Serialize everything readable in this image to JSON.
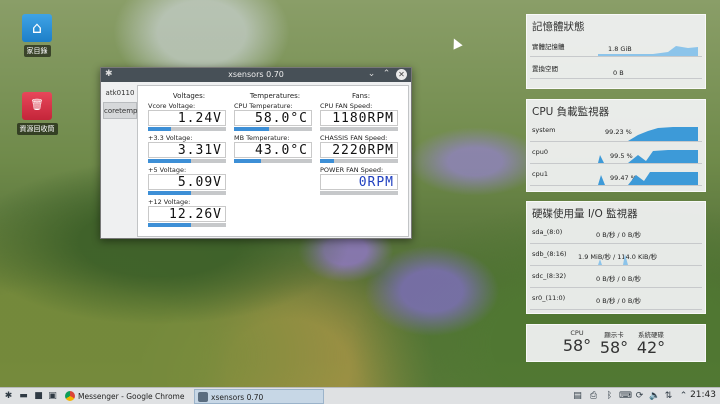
{
  "desktop": {
    "icons": [
      {
        "label": "家目錄",
        "icon": "home-folder-icon"
      },
      {
        "label": "資源回收筒",
        "icon": "trash-icon"
      }
    ]
  },
  "xsensors": {
    "title": "xsensors 0.70",
    "tabs": [
      "atk0110",
      "coretemp"
    ],
    "active_tab": "coretemp",
    "voltages": {
      "header": "Voltages:",
      "items": [
        {
          "label": "Vcore Voltage:",
          "value": "1.24V",
          "level": 0.3
        },
        {
          "label": "+3.3 Voltage:",
          "value": "3.31V",
          "level": 0.55
        },
        {
          "label": "+5 Voltage:",
          "value": "5.09V",
          "level": 0.55
        },
        {
          "label": "+12 Voltage:",
          "value": "12.26V",
          "level": 0.55
        }
      ]
    },
    "temperatures": {
      "header": "Temperatures:",
      "items": [
        {
          "label": "CPU Temperature:",
          "value": "58.0°C",
          "level": 0.45
        },
        {
          "label": "MB Temperature:",
          "value": "43.0°C",
          "level": 0.35
        }
      ]
    },
    "fans": {
      "header": "Fans:",
      "items": [
        {
          "label": "CPU FAN Speed:",
          "value": "1180RPM",
          "level": 0.0
        },
        {
          "label": "CHASSIS FAN Speed:",
          "value": "2220RPM",
          "level": 0.18
        },
        {
          "label": "POWER FAN Speed:",
          "value": "0RPM",
          "level": 0.0
        }
      ]
    }
  },
  "memory_widget": {
    "title": "記憶體狀態",
    "rows": [
      {
        "label": "實體記憶體",
        "value": "1.8 GiB"
      },
      {
        "label": "置換空間",
        "value": "0 B"
      }
    ]
  },
  "cpu_widget": {
    "title": "CPU 負載監視器",
    "rows": [
      {
        "label": "system",
        "value": "99.23 %"
      },
      {
        "label": "cpu0",
        "value": "99.5 %"
      },
      {
        "label": "cpu1",
        "value": "99.47 %"
      }
    ]
  },
  "disk_widget": {
    "title": "硬碟使用量 I/O 監視器",
    "rows": [
      {
        "label": "sda_(8:0)",
        "value": "0 B/秒 / 0 B/秒"
      },
      {
        "label": "sdb_(8:16)",
        "value": "1.9 MiB/秒 / 114.0 KiB/秒"
      },
      {
        "label": "sdc_(8:32)",
        "value": "0 B/秒 / 0 B/秒"
      },
      {
        "label": "sr0_(11:0)",
        "value": "0 B/秒 / 0 B/秒"
      }
    ]
  },
  "temps_widget": {
    "items": [
      {
        "label": "CPU",
        "value": "58°"
      },
      {
        "label": "顯示卡",
        "value": "58°"
      },
      {
        "label": "系統硬碟",
        "value": "42°"
      }
    ]
  },
  "taskbar": {
    "tasks": [
      {
        "label": "Messenger - Google Chrome",
        "icon": "chrome-icon",
        "active": false
      },
      {
        "label": "xsensors 0.70",
        "icon": "xsensors-icon",
        "active": true
      }
    ],
    "clock": "21:43"
  },
  "colors": {
    "accent": "#3d8fd6",
    "fan_text": "#1f3fbf",
    "titlebar": "#475057"
  }
}
